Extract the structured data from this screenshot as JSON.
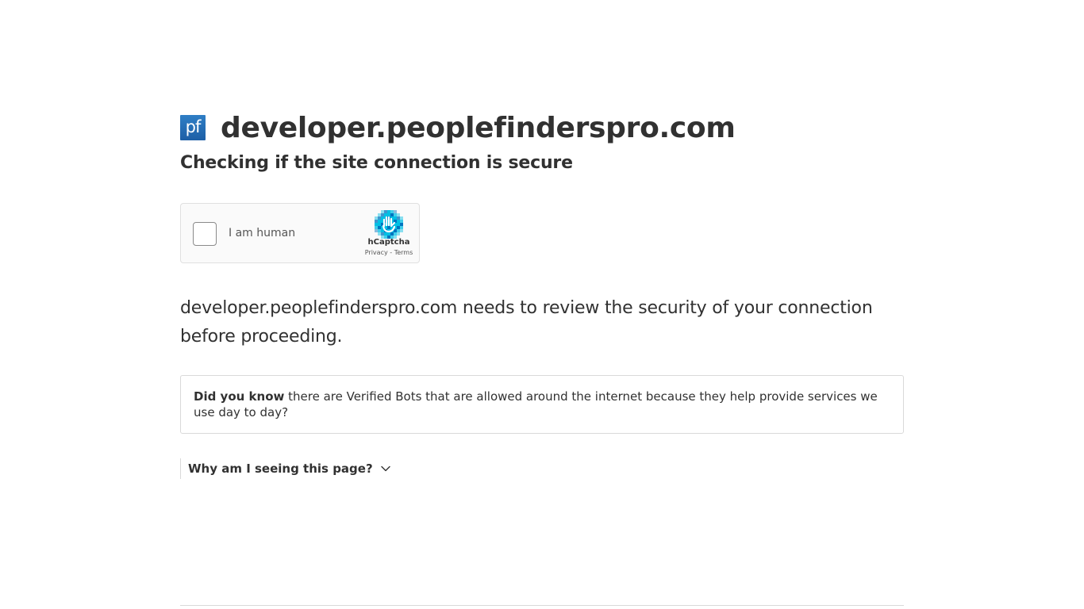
{
  "header": {
    "favicon_text": "pf",
    "site_name": "developer.peoplefinderspro.com"
  },
  "subtitle": "Checking if the site connection is secure",
  "captcha": {
    "label": "I am human",
    "brand": "hCaptcha",
    "privacy_link": "Privacy",
    "separator": " - ",
    "terms_link": "Terms",
    "logo_icon": "hcaptcha-hand-icon",
    "accent_color": "#0074bf",
    "secondary_color": "#00bfe4"
  },
  "main": {
    "description": "developer.peoplefinderspro.com needs to review the security of your connection before proceeding."
  },
  "info": {
    "lead": "Did you know",
    "text": " there are Verified Bots that are allowed around the internet because they help provide services we use day to day?"
  },
  "why": {
    "label": "Why am I seeing this page?",
    "icon": "chevron-down-icon"
  }
}
